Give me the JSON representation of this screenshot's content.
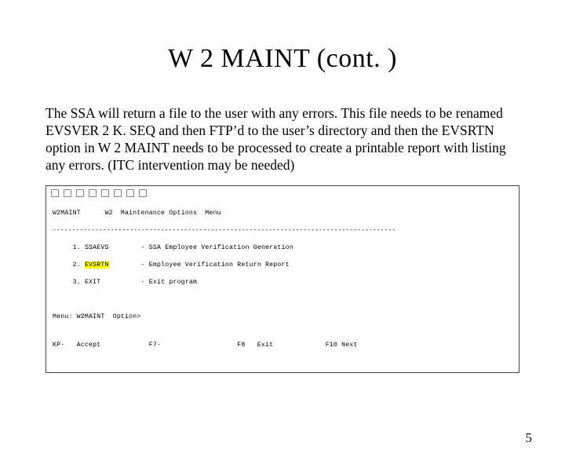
{
  "title": "W 2 MAINT (cont. )",
  "paragraph": "The SSA will return a file to the user with any errors. This file needs to be renamed EVSVER 2 K. SEQ and then FTP’d to the user’s directory and then the EVSRTN option in W 2 MAINT needs to be processed to create a printable report with listing any errors. (ITC intervention may be needed)",
  "terminal": {
    "header": "W2MAINT      W2  Maintenance Options  Menu",
    "dashes": "-----------------------------------------------------------------------------------------",
    "options": [
      {
        "num": "1.",
        "code": "SSAEVS",
        "desc": "- SSA Employee Verification Generation",
        "highlight": false
      },
      {
        "num": "2.",
        "code": "EVSRTN",
        "desc": "- Employee Verification Return Report",
        "highlight": true
      },
      {
        "num": "3.",
        "code": "EXIT",
        "desc": "- Exit program",
        "highlight": false
      }
    ],
    "menu_prompt": "Menu: W2MAINT  Option>",
    "kp_line": "KP-   Accept            F7-                   F8   Exit             F10 Next"
  },
  "page_number": "5"
}
